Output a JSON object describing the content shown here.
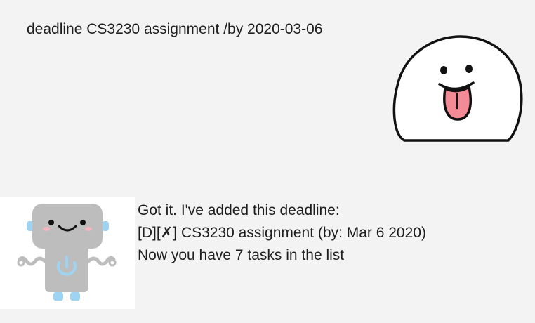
{
  "user_message": {
    "text": "deadline CS3230 assignment /by 2020-03-06",
    "avatar_icon": "tongue-out-face-icon"
  },
  "bot_message": {
    "avatar_icon": "robot-power-icon",
    "line1": "Got it. I've added this deadline:",
    "line2_prefix": "[D][",
    "line2_mark": "✗",
    "line2_suffix": "] CS3230 assignment (by: Mar 6 2020)",
    "line3": "Now you have 7 tasks in the list"
  },
  "colors": {
    "background": "#f3f3f3",
    "text": "#1e1e1e",
    "robot_body": "#bdbdbd",
    "robot_accent": "#9fd3f2",
    "tongue": "#f28b95"
  }
}
